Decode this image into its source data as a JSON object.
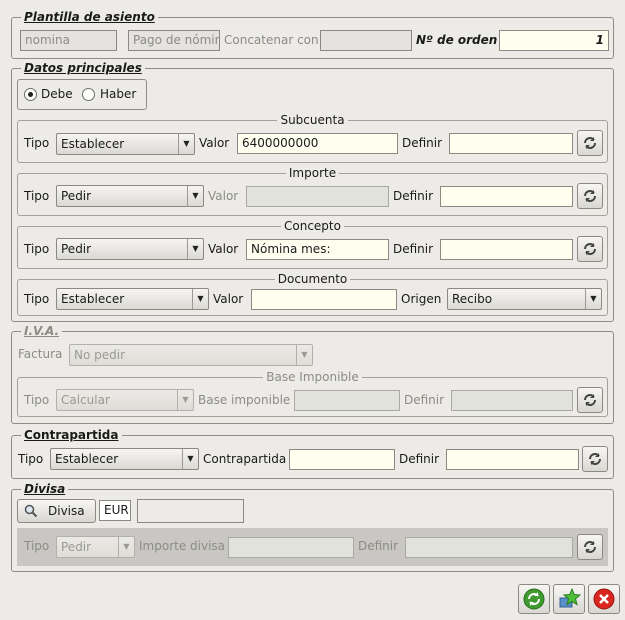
{
  "plantilla": {
    "title": "Plantilla de asiento",
    "nomina": "nomina",
    "pago": "Pago de nómin",
    "concat_label": "Concatenar con",
    "concat_value": "",
    "orden_label": "Nº de orden",
    "orden_value": "1"
  },
  "datos": {
    "title": "Datos principales",
    "debe": "Debe",
    "haber": "Haber",
    "selected": "Debe",
    "subcuenta": {
      "title": "Subcuenta",
      "tipo_label": "Tipo",
      "tipo": "Establecer",
      "valor_label": "Valor",
      "valor": "6400000000",
      "definir_label": "Definir",
      "definir": ""
    },
    "importe": {
      "title": "Importe",
      "tipo_label": "Tipo",
      "tipo": "Pedir",
      "valor_label": "Valor",
      "valor": "",
      "definir_label": "Definir",
      "definir": ""
    },
    "concepto": {
      "title": "Concepto",
      "tipo_label": "Tipo",
      "tipo": "Pedir",
      "valor_label": "Valor",
      "valor": "Nómina mes:",
      "definir_label": "Definir",
      "definir": ""
    },
    "documento": {
      "title": "Documento",
      "tipo_label": "Tipo",
      "tipo": "Establecer",
      "valor_label": "Valor",
      "valor": "",
      "origen_label": "Origen",
      "origen": "Recibo"
    }
  },
  "iva": {
    "title": "I.V.A.",
    "factura_label": "Factura",
    "factura": "No pedir",
    "base": {
      "title": "Base Imponible",
      "tipo_label": "Tipo",
      "tipo": "Calcular",
      "base_label": "Base imponible",
      "base_value": "",
      "definir_label": "Definir",
      "definir": ""
    }
  },
  "contrapartida": {
    "title": "Contrapartida",
    "tipo_label": "Tipo",
    "tipo": "Establecer",
    "contra_label": "Contrapartida",
    "contra_value": "",
    "definir_label": "Definir",
    "definir": ""
  },
  "divisa": {
    "title": "Divisa",
    "button_label": "Divisa",
    "code": "EUR",
    "name": "",
    "tipo_label": "Tipo",
    "tipo": "Pedir",
    "importe_label": "Importe divisa",
    "importe_value": "",
    "definir_label": "Definir",
    "definir": ""
  },
  "icons": {
    "definir": "refresh-arrows-icon",
    "accept": "green-cycle-icon",
    "save": "star-add-icon",
    "cancel": "red-close-icon"
  }
}
